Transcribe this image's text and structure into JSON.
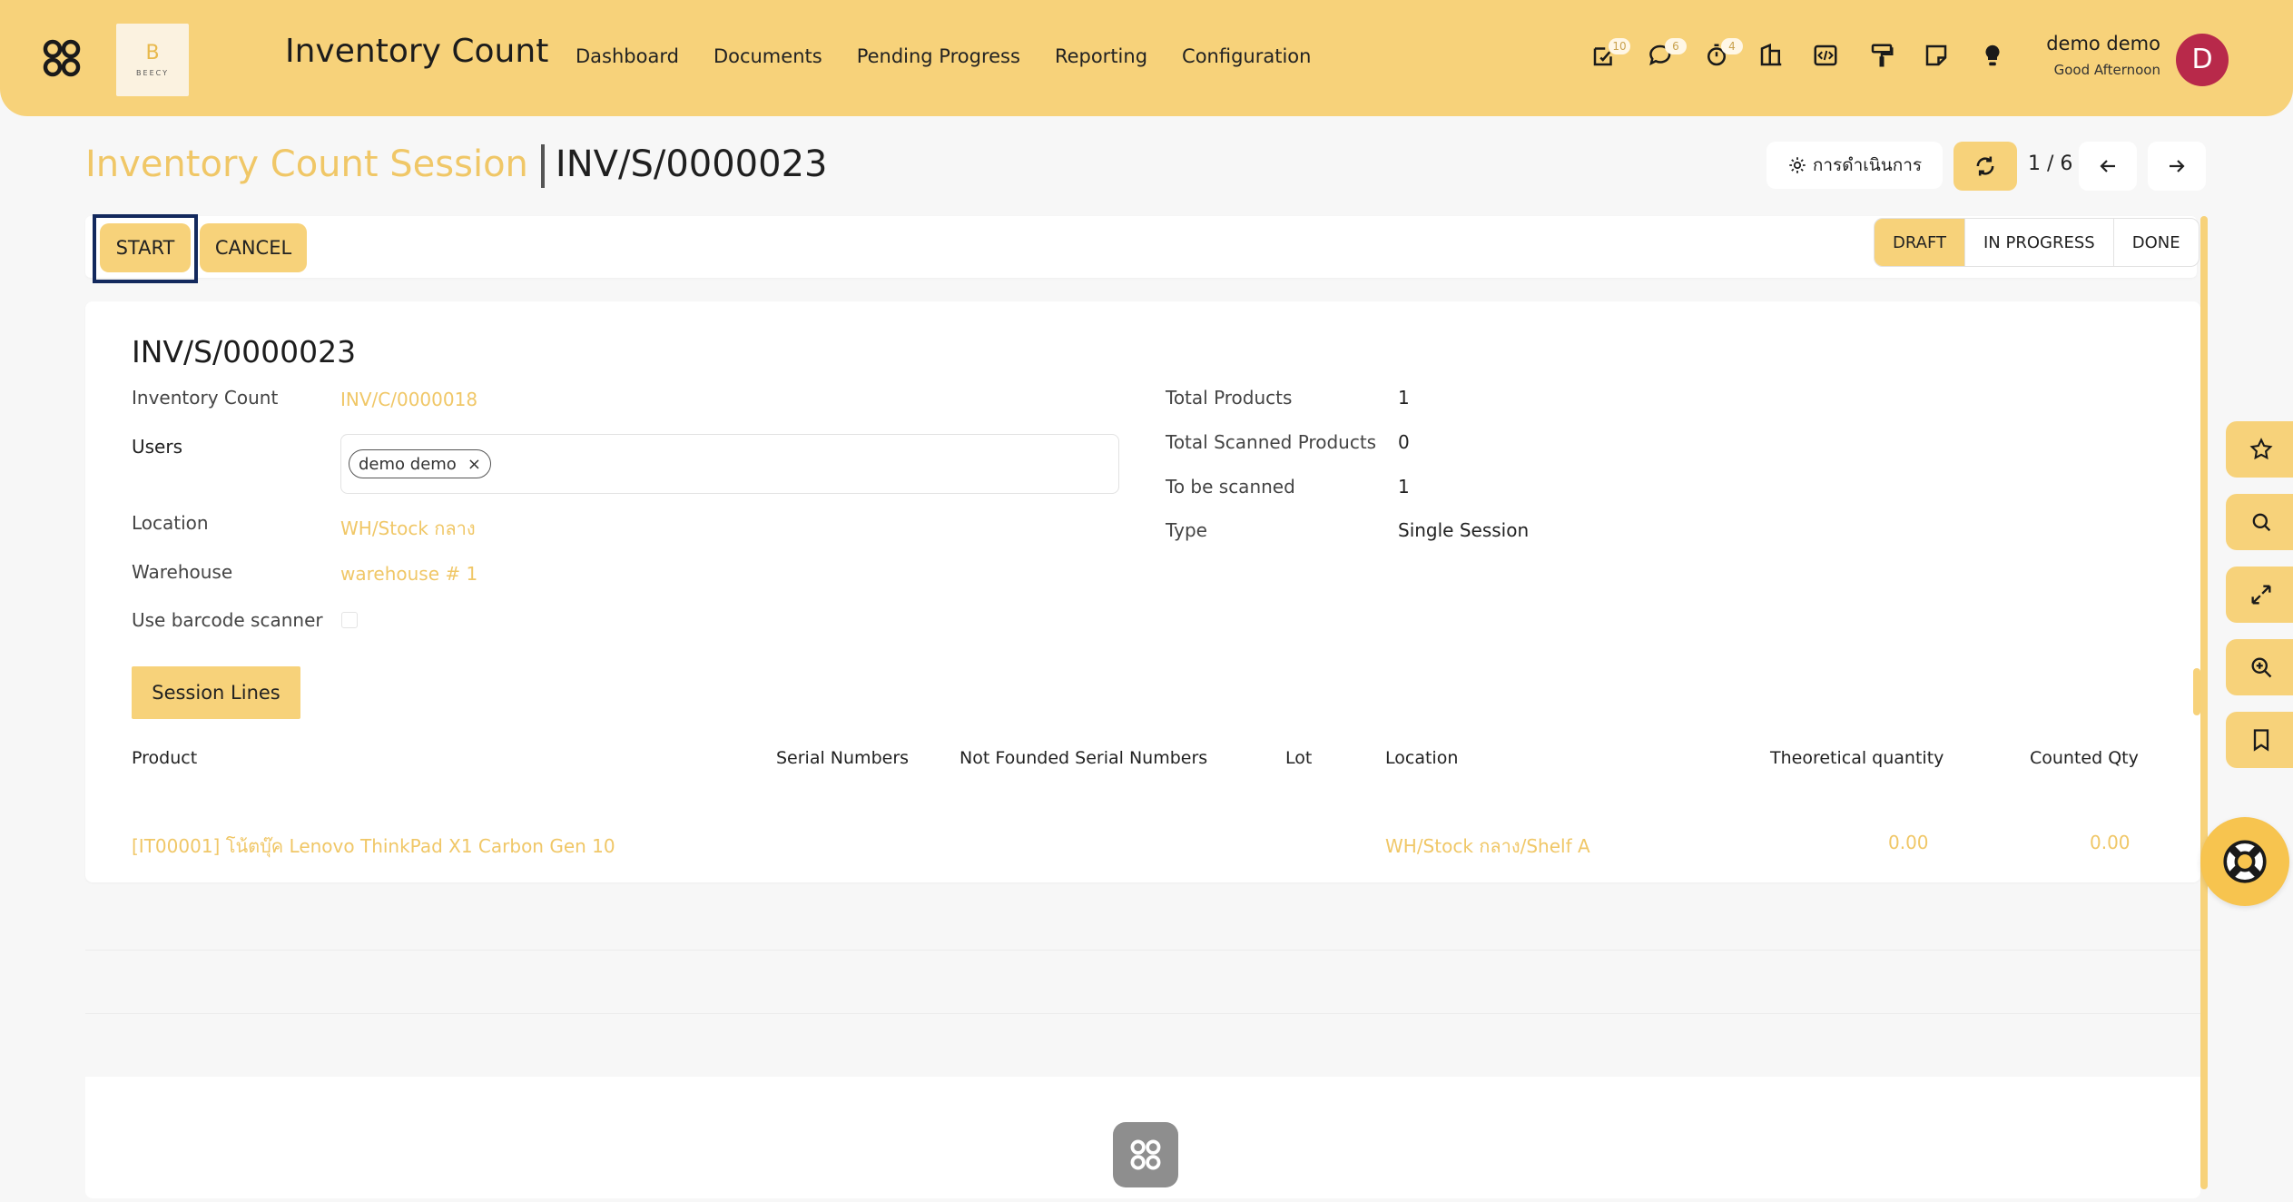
{
  "header": {
    "logo_text": "BEECY",
    "logo_letter": "B",
    "app_title": "Inventory Count",
    "nav": [
      "Dashboard",
      "Documents",
      "Pending Progress",
      "Reporting",
      "Configuration"
    ],
    "system_icons": [
      {
        "name": "activity-icon",
        "badge": "10"
      },
      {
        "name": "chat-icon",
        "badge": "6"
      },
      {
        "name": "timer-icon",
        "badge": "4"
      },
      {
        "name": "building-icon",
        "badge": ""
      },
      {
        "name": "code-icon",
        "badge": ""
      },
      {
        "name": "paint-roller-icon",
        "badge": ""
      },
      {
        "name": "note-icon",
        "badge": ""
      },
      {
        "name": "lightbulb-icon",
        "badge": ""
      }
    ],
    "user": {
      "name": "demo demo",
      "greeting": "Good Afternoon",
      "avatar_letter": "D"
    }
  },
  "breadcrumb": {
    "parent": "Inventory Count Session",
    "current": "INV/S/0000023"
  },
  "control_panel": {
    "action_label": "การดำเนินการ",
    "pager": "1 / 6",
    "buttons": {
      "start": "START",
      "cancel": "CANCEL"
    },
    "stages": [
      {
        "label": "DRAFT",
        "active": true
      },
      {
        "label": "IN PROGRESS",
        "active": false
      },
      {
        "label": "DONE",
        "active": false
      }
    ]
  },
  "form": {
    "title": "INV/S/0000023",
    "fields_left": {
      "inventory_count": {
        "label": "Inventory Count",
        "value": "INV/C/0000018"
      },
      "users": {
        "label": "Users",
        "tags": [
          "demo demo"
        ],
        "remove_glyph": "×"
      },
      "location": {
        "label": "Location",
        "value": "WH/Stock กลาง"
      },
      "warehouse": {
        "label": "Warehouse",
        "value": "warehouse # 1"
      },
      "barcode": {
        "label": "Use barcode scanner",
        "checked": false
      }
    },
    "fields_right": {
      "total_products": {
        "label": "Total Products",
        "value": "1"
      },
      "total_scanned": {
        "label": "Total Scanned Products",
        "value": "0"
      },
      "to_be_scanned": {
        "label": "To be scanned",
        "value": "1"
      },
      "type": {
        "label": "Type",
        "value": "Single Session"
      }
    },
    "tab_label": "Session Lines",
    "table": {
      "columns": {
        "product": "Product",
        "serial": "Serial Numbers",
        "not_found_serial": "Not Founded Serial Numbers",
        "lot": "Lot",
        "location": "Location",
        "theoretical": "Theoretical quantity",
        "counted": "Counted Qty"
      },
      "rows": [
        {
          "product": "[IT00001] โน้ตบุ๊ค Lenovo ThinkPad X1 Carbon Gen 10",
          "serial": "",
          "not_found_serial": "",
          "lot": "",
          "location": "WH/Stock กลาง/Shelf A",
          "theoretical": "0.00",
          "counted": "0.00"
        }
      ]
    }
  },
  "side_tools": [
    "star-icon",
    "search-icon",
    "expand-icon",
    "zoom-in-icon",
    "bookmark-icon"
  ],
  "colors": {
    "accent": "#f7d27a",
    "link": "#f0c767",
    "avatar": "#b8294a",
    "focus": "#13295d"
  }
}
